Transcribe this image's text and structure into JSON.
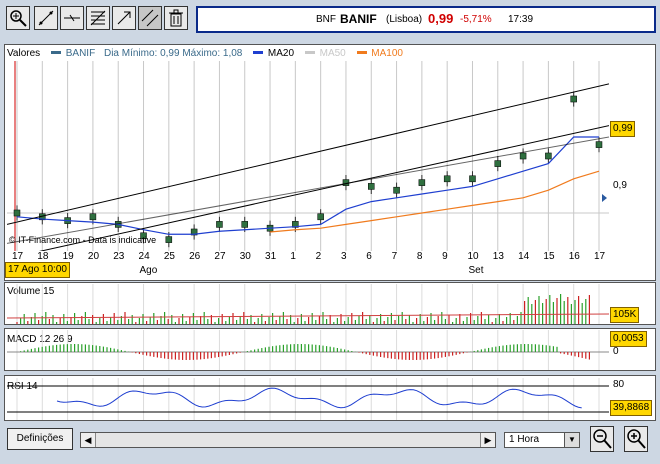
{
  "toolbar": {
    "buttons": [
      {
        "name": "zoom-rect-tool",
        "icon": "magnifier-zoom-icon"
      },
      {
        "name": "line-tool",
        "icon": "line-draw-icon"
      },
      {
        "name": "horizontal-line-tool",
        "icon": "horizontal-line-icon"
      },
      {
        "name": "fibonacci-tool",
        "icon": "fibonacci-icon"
      },
      {
        "name": "trend-tool",
        "icon": "trend-arrow-icon"
      },
      {
        "name": "channel-tool",
        "icon": "channel-icon"
      },
      {
        "name": "delete-tool",
        "icon": "trash-icon"
      }
    ]
  },
  "quote": {
    "exchange": "BNF",
    "symbol": "BANIF",
    "market": "(Lisboa)",
    "price": "0,99",
    "change": "-5,71%",
    "time": "17:39"
  },
  "main_chart": {
    "legend_label": "Valores",
    "series_name": "BANIF",
    "range_text": "Dia Mínimo: 0,99 Máximo: 1,08",
    "ma20": "MA20",
    "ma50": "MA50",
    "ma100": "MA100",
    "price_tag": "0,99",
    "y_tick": "0,9",
    "watermark": "© IT-Finance.com - Data is indicative",
    "date_tag": "17 Ago 10:00",
    "x_labels": [
      "17",
      "18",
      "19",
      "20",
      "23",
      "24",
      "25",
      "26",
      "27",
      "30",
      "31",
      "1",
      "2",
      "3",
      "6",
      "7",
      "8",
      "9",
      "10",
      "13",
      "14",
      "15",
      "16",
      "17"
    ],
    "month_labels": [
      "Ago",
      "Set"
    ],
    "colors": {
      "ma20": "#1f3fd0",
      "ma50": "#c8c8c8",
      "ma100": "#f07b1e",
      "series": "#333333"
    }
  },
  "chart_data": {
    "type": "line",
    "title": "",
    "ylabel": "",
    "ylim": [
      0.85,
      1.1
    ],
    "x": [
      "17",
      "18",
      "19",
      "20",
      "23",
      "24",
      "25",
      "26",
      "27",
      "30",
      "31",
      "1",
      "2",
      "3",
      "6",
      "7",
      "8",
      "9",
      "10",
      "13",
      "14",
      "15",
      "16",
      "17"
    ],
    "series": [
      {
        "name": "BANIF",
        "values": [
          0.9,
          0.895,
          0.89,
          0.895,
          0.885,
          0.87,
          0.865,
          0.875,
          0.885,
          0.885,
          0.88,
          0.885,
          0.895,
          0.94,
          0.935,
          0.93,
          0.94,
          0.945,
          0.945,
          0.965,
          0.975,
          0.975,
          1.05,
          0.99
        ]
      },
      {
        "name": "MA20",
        "values": [
          0.895,
          0.892,
          0.89,
          0.888,
          0.885,
          0.878,
          0.872,
          0.872,
          0.876,
          0.878,
          0.88,
          0.882,
          0.885,
          0.905,
          0.915,
          0.92,
          0.925,
          0.93,
          0.935,
          0.945,
          0.955,
          0.965,
          1.0,
          1.0
        ]
      },
      {
        "name": "MA100",
        "values": [
          null,
          null,
          null,
          null,
          null,
          null,
          null,
          null,
          null,
          null,
          0.875,
          0.878,
          0.88,
          0.885,
          0.89,
          0.895,
          0.9,
          0.905,
          0.91,
          0.915,
          0.92,
          0.93,
          0.945,
          0.955
        ]
      }
    ]
  },
  "volume_panel": {
    "label": "Volume 15",
    "tag": "105K"
  },
  "macd_panel": {
    "label": "MACD 12 26 9",
    "tag": "0,0053",
    "zero_label": "0"
  },
  "rsi_panel": {
    "label": "RSI 14",
    "tag": "39,8868",
    "y80": "80",
    "y20": "20"
  },
  "bottom": {
    "settings_label": "Definições",
    "interval": "1 Hora"
  }
}
